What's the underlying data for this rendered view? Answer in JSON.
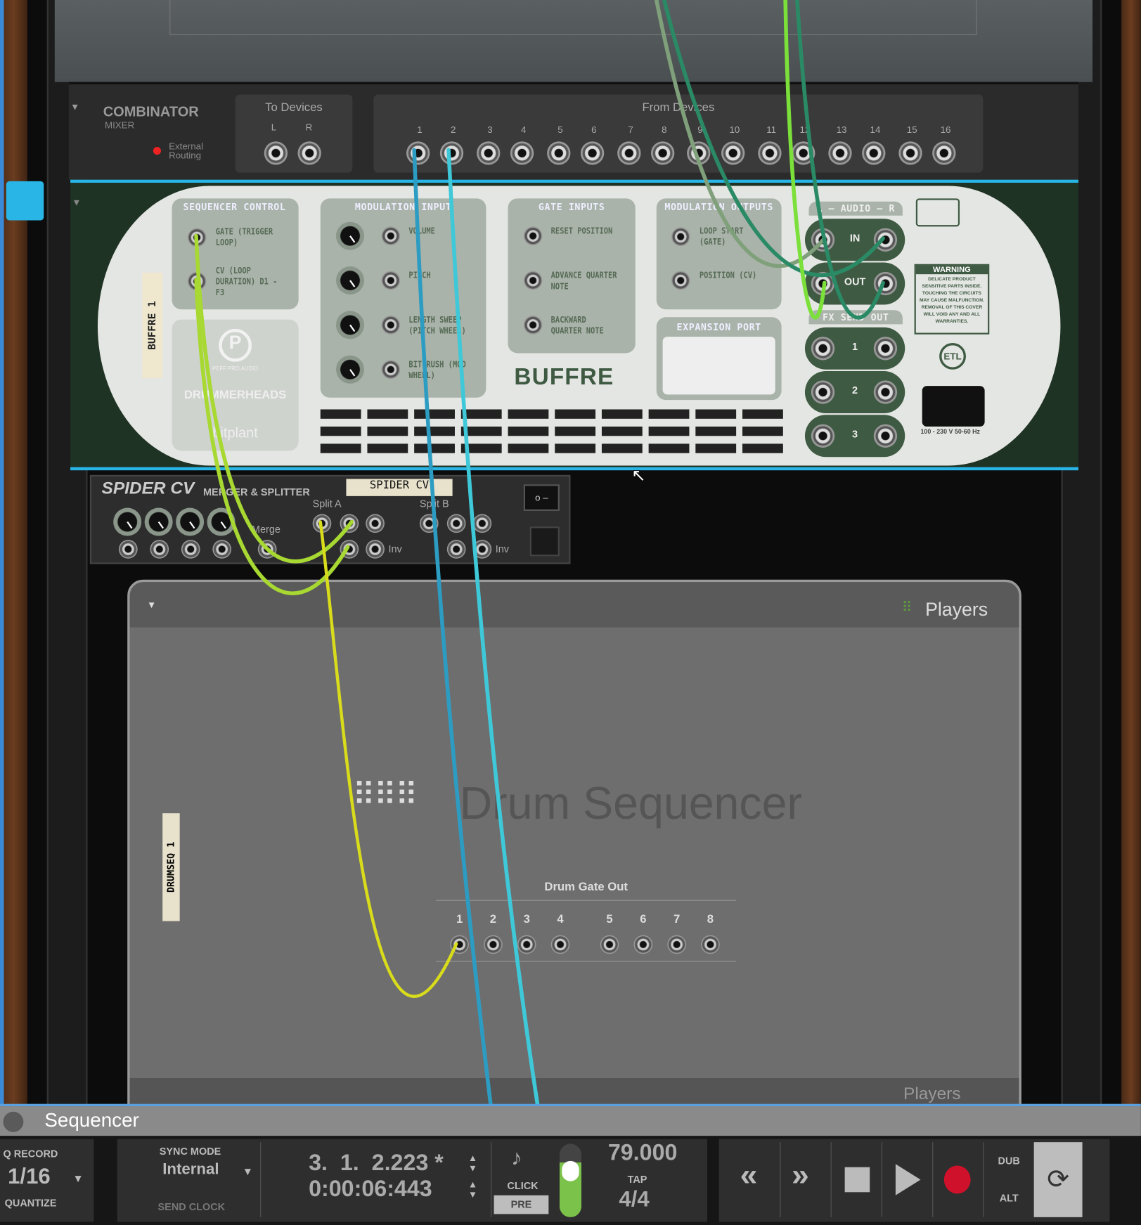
{
  "combinator": {
    "title": "COMBINATOR",
    "subtitle": "MIXER",
    "external_routing": "External Routing",
    "to_devices": "To Devices",
    "to_channels": [
      "L",
      "R"
    ],
    "from_devices": "From Devices",
    "from_channels": [
      "1",
      "2",
      "3",
      "4",
      "5",
      "6",
      "7",
      "8",
      "9",
      "10",
      "11",
      "12",
      "13",
      "14",
      "15",
      "16"
    ]
  },
  "buffre": {
    "tape_label": "BUFFRE 1",
    "brand": "BUFFRE",
    "sequencer_control": {
      "title": "SEQUENCER CONTROL",
      "items": [
        "GATE (TRIGGER LOOP)",
        "CV (LOOP DURATION) D1 - F3"
      ]
    },
    "modulation_input": {
      "title": "MODULATION INPUT",
      "items": [
        "VOLUME",
        "PITCH",
        "LENGTH SWEEP (PITCH WHEEL)",
        "BITCRUSH (MOD WHEEL)"
      ]
    },
    "gate_inputs": {
      "title": "GATE INPUTS",
      "items": [
        "RESET POSITION",
        "ADVANCE QUARTER NOTE",
        "BACKWARD QUARTER NOTE"
      ]
    },
    "modulation_outputs": {
      "title": "MODULATION OUTPUTS",
      "items": [
        "LOOP START (GATE)",
        "POSITION (CV)"
      ]
    },
    "expansion_port": "EXPANSION PORT",
    "audio_title": "L — AUDIO — R",
    "audio_in": "IN",
    "audio_out": "OUT",
    "fx_title": "FX SEND OUT",
    "fx": [
      "1",
      "2",
      "3"
    ],
    "warning_title": "WARNING",
    "warning_text": "DELICATE PRODUCT SENSITIVE PARTS INSIDE. TOUCHING THE CIRCUITS MAY CAUSE MALFUNCTION. REMOVAL OF THIS COVER WILL VOID ANY AND ALL WARRANTIES.",
    "power": "100 - 230 V  50-60 Hz",
    "logo_peff": "PEFF PRO AUDIO",
    "logo_drummerheads": "DRUMMERHEADS",
    "logo_bitplant": "bitplant"
  },
  "spider": {
    "title": "SPIDER CV",
    "subtitle": "MERGER & SPLITTER",
    "tape_label": "SPIDER CV",
    "merge": "Merge",
    "split_a": "Split A",
    "split_b": "Split B",
    "inv": "Inv"
  },
  "drumseq": {
    "brand": "Players",
    "title": "Drum Sequencer",
    "tape_label": "DRUMSEQ 1",
    "gate_out": "Drum Gate Out",
    "gates": [
      "1",
      "2",
      "3",
      "4",
      "5",
      "6",
      "7",
      "8"
    ]
  },
  "track": {
    "name": "Sequencer"
  },
  "transport": {
    "q_record": "Q RECORD",
    "quantize_value": "1/16",
    "quantize": "QUANTIZE",
    "sync_mode": "SYNC MODE",
    "sync_value": "Internal",
    "send_clock": "SEND CLOCK",
    "position_bars": "3.  1.  2.223 *",
    "position_time": "0:00:06:443",
    "click": "CLICK",
    "pre": "PRE",
    "tempo": "79.000",
    "tap": "TAP",
    "signature": "4/4",
    "dub": "DUB",
    "alt": "ALT",
    "click_level": 0.75
  },
  "colors": {
    "accent": "#29b6e6",
    "record": "#d0112b",
    "buffre_green": "#3f5a42"
  }
}
